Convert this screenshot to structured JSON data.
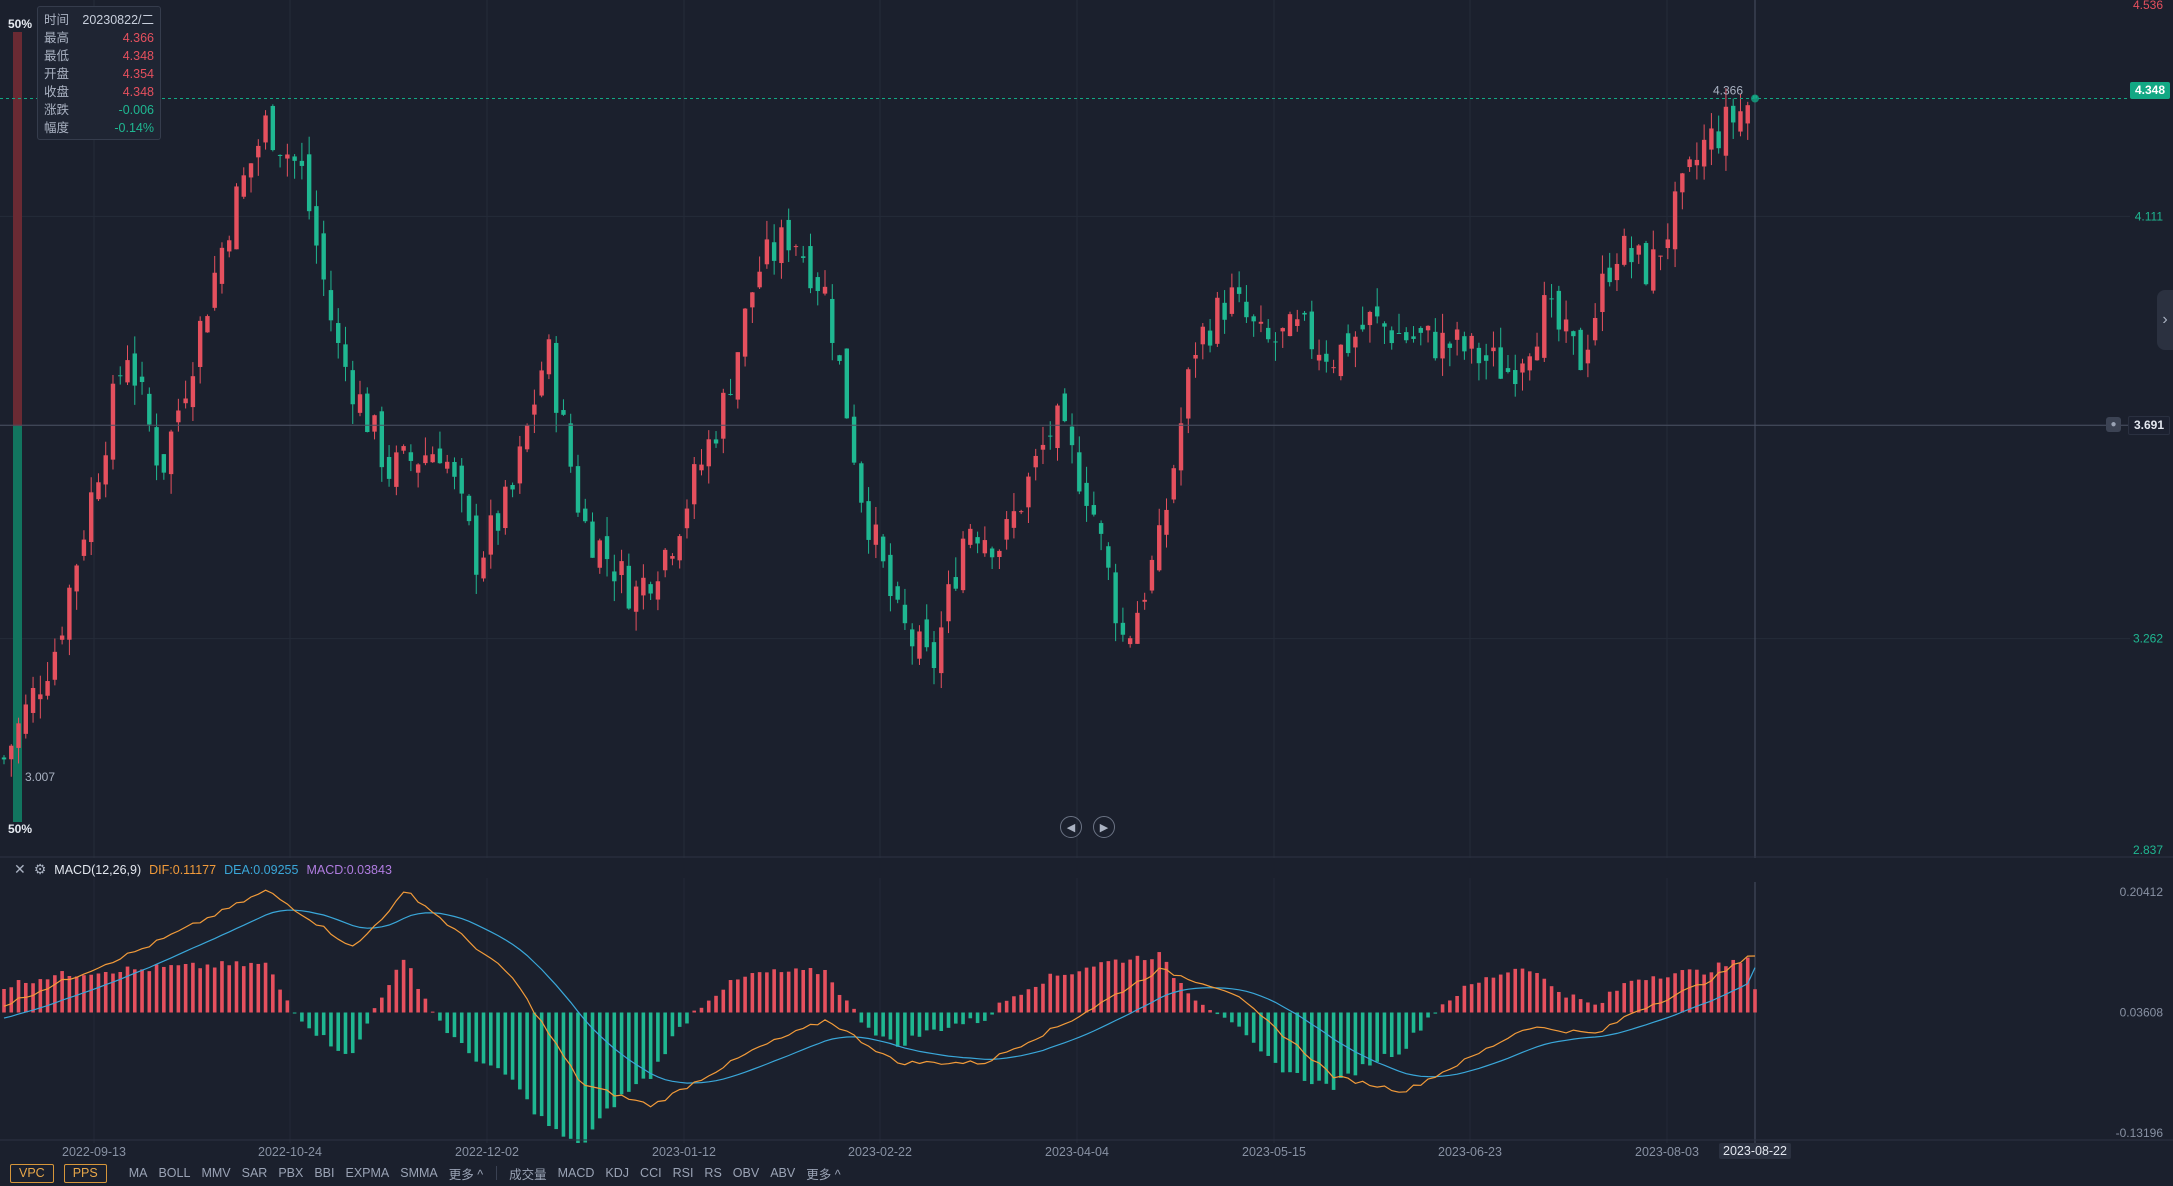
{
  "tooltip": {
    "rows": [
      {
        "label": "时间",
        "value": "20230822/二"
      },
      {
        "label": "最高",
        "value": "4.366"
      },
      {
        "label": "最低",
        "value": "4.348"
      },
      {
        "label": "开盘",
        "value": "4.354"
      },
      {
        "label": "收盘",
        "value": "4.348"
      },
      {
        "label": "涨跌",
        "value": "-0.006"
      },
      {
        "label": "幅度",
        "value": "-0.14%"
      }
    ]
  },
  "volume_profile": {
    "top_label": "50%",
    "bottom_label": "50%"
  },
  "price_axis": {
    "labels": [
      {
        "value": 4.536,
        "text": "4.536"
      },
      {
        "value": 4.111,
        "text": "4.111"
      },
      {
        "value": 3.262,
        "text": "3.262"
      },
      {
        "value": 2.837,
        "text": "2.837"
      }
    ],
    "last_price": "4.348",
    "crosshair_price": "3.691"
  },
  "annotations": {
    "high": "4.366",
    "low": "3.007"
  },
  "macd": {
    "name": "MACD(12,26,9)",
    "dif": "DIF:0.11177",
    "dea": "DEA:0.09255",
    "macd": "MACD:0.03843",
    "axis": {
      "top": "0.20412",
      "mid": "0.03608",
      "bottom": "-0.13196"
    }
  },
  "dates": [
    "2022-09-13",
    "2022-10-24",
    "2022-12-02",
    "2023-01-12",
    "2023-02-22",
    "2023-04-04",
    "2023-05-15",
    "2023-06-23",
    "2023-08-03"
  ],
  "active_date": "2023-08-22",
  "toolbar": {
    "boxes": [
      "VPC",
      "PPS"
    ],
    "main_indicators": [
      "MA",
      "BOLL",
      "MMV",
      "SAR",
      "PBX",
      "BBI",
      "EXPMA",
      "SMMA",
      "更多 ^"
    ],
    "sub_indicators": [
      "成交量",
      "MACD",
      "KDJ",
      "CCI",
      "RSI",
      "RS",
      "OBV",
      "ABV",
      "更多 ^"
    ]
  },
  "colors": {
    "up": "#e5505e",
    "down": "#1fb791",
    "dif": "#f29b3a",
    "dea": "#3aa7d9",
    "accent": "#12a884"
  },
  "icons": {
    "close": "close-icon",
    "settings": "gear-icon",
    "prev": "skip-back-icon",
    "next": "skip-forward-icon",
    "bell": "bell-icon",
    "expand": "chevron-right-icon"
  }
}
